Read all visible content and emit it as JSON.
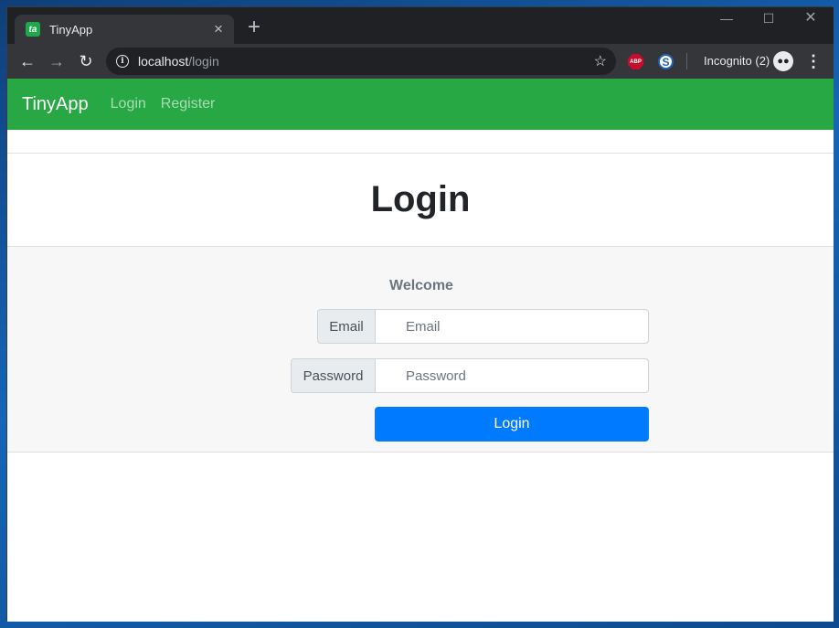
{
  "browser": {
    "tab_title": "TinyApp",
    "favicon_text": "ta",
    "url_host": "localhost",
    "url_path": "/login",
    "incognito_label": "Incognito (2)",
    "abp_label": "ABP",
    "s_ext_label": "S"
  },
  "navbar": {
    "brand": "TinyApp",
    "links": [
      {
        "label": "Login"
      },
      {
        "label": "Register"
      }
    ],
    "accent_color": "#28a745"
  },
  "card": {
    "title": "Login",
    "welcome": "Welcome",
    "email": {
      "label": "Email",
      "placeholder": "Email",
      "value": ""
    },
    "password": {
      "label": "Password",
      "placeholder": "Password",
      "value": ""
    },
    "submit_label": "Login",
    "button_color": "#007bff"
  },
  "icons": {
    "back": "arrow-left-icon",
    "forward": "arrow-right-icon",
    "reload": "reload-icon",
    "info": "info-icon",
    "star": "star-icon",
    "menu": "more-vert-icon",
    "incognito": "incognito-icon"
  }
}
